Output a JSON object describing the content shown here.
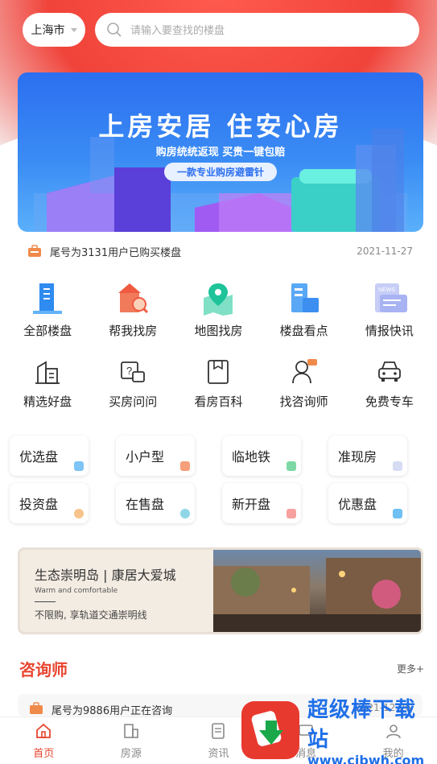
{
  "search": {
    "city": "上海市",
    "placeholder": "请输入要查找的楼盘"
  },
  "banner": {
    "title": "上房安居 住安心房",
    "subtitle": "购房统统返现 买贵一键包赔",
    "pill": "一款专业购房避雷针"
  },
  "notice": {
    "text": "尾号为3131用户已购买楼盘",
    "date": "2021-11-27"
  },
  "menu_row1": [
    {
      "label": "全部楼盘",
      "icon": "buildings-icon"
    },
    {
      "label": "帮我找房",
      "icon": "house-search-icon"
    },
    {
      "label": "地图找房",
      "icon": "map-pin-icon"
    },
    {
      "label": "楼盘看点",
      "icon": "building-highlight-icon"
    },
    {
      "label": "情报快讯",
      "icon": "news-icon"
    }
  ],
  "menu_row2": [
    {
      "label": "精选好盘",
      "icon": "selected-building-icon"
    },
    {
      "label": "买房问问",
      "icon": "question-chat-icon"
    },
    {
      "label": "看房百科",
      "icon": "book-icon"
    },
    {
      "label": "找咨询师",
      "icon": "consultant-icon"
    },
    {
      "label": "免费专车",
      "icon": "car-icon"
    }
  ],
  "tags_row1": [
    "优选盘",
    "小户型",
    "临地铁",
    "准现房"
  ],
  "tags_row2": [
    "投资盘",
    "在售盘",
    "新开盘",
    "优惠盘"
  ],
  "ad": {
    "headline": "生态崇明岛 | 康居大爱城",
    "english": "Warm and comfortable",
    "sub": "不限购, 享轨道交通崇明线"
  },
  "section": {
    "title": "咨询师",
    "more": "更多+"
  },
  "notice2": {
    "text": "尾号为9886用户正在咨询",
    "date": "2021-12-26"
  },
  "tabs": [
    "首页",
    "房源",
    "资讯",
    "消息",
    "我的"
  ],
  "watermark": {
    "name": "超级棒下载站",
    "url": "www.cjbwh.com"
  },
  "colors": {
    "accent": "#e8452f",
    "banner": "#2c6ff0"
  }
}
